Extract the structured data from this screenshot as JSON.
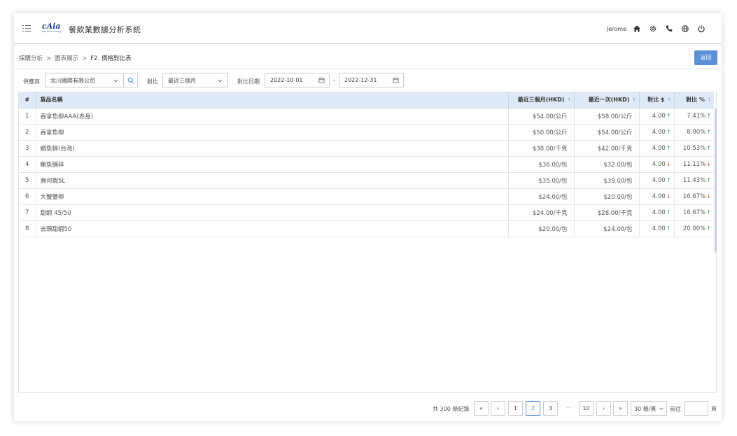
{
  "header": {
    "logo_text": "cAia",
    "logo_subtext": "City of Accounting",
    "app_title": "餐飲業數據分析系統",
    "user_name": "Jerome"
  },
  "breadcrumb": {
    "items": [
      "採購分析",
      "圖表展示",
      "F2. 價格對比表"
    ],
    "separator": ">"
  },
  "back_button": "返回",
  "filters": {
    "supplier_label": "供應商",
    "supplier_value": "北川國際有限公司",
    "compare_label": "對比",
    "compare_value": "最近三個月",
    "date_label": "對比日期",
    "date_from": "2022-10-01",
    "date_separator": "–",
    "date_to": "2022-12-31"
  },
  "table": {
    "columns": [
      "#",
      "貨品名稱",
      "最近三個月(HKD)",
      "最近一次(HKD)",
      "對比 $",
      "對比 %"
    ],
    "rows": [
      {
        "no": "1",
        "name": "吞拿魚柳AAA(赤身)",
        "avg3m": "$54.00/公斤",
        "last": "$58.00/公斤",
        "diff": "4.00",
        "diff_dir": "up",
        "pct": "7.41%",
        "pct_dir": "up"
      },
      {
        "no": "2",
        "name": "吞拿魚柳",
        "avg3m": "$50.00/公斤",
        "last": "$54.00/公斤",
        "diff": "4.00",
        "diff_dir": "up",
        "pct": "8.00%",
        "pct_dir": "up"
      },
      {
        "no": "3",
        "name": "鯛魚柳(台灣)",
        "avg3m": "$38.00/千克",
        "last": "$42.00/千克",
        "diff": "4.00",
        "diff_dir": "up",
        "pct": "10.53%",
        "pct_dir": "up"
      },
      {
        "no": "4",
        "name": "鮪魚腩碎",
        "avg3m": "$36.00/包",
        "last": "$32.00/包",
        "diff": "4.00",
        "diff_dir": "down",
        "pct": "11.11%",
        "pct_dir": "down"
      },
      {
        "no": "5",
        "name": "壽司蝦5L",
        "avg3m": "$35.00/包",
        "last": "$39.00/包",
        "diff": "4.00",
        "diff_dir": "up",
        "pct": "11.43%",
        "pct_dir": "up"
      },
      {
        "no": "6",
        "name": "大蟹蟹柳",
        "avg3m": "$24.00/包",
        "last": "$20.00/包",
        "diff": "4.00",
        "diff_dir": "down",
        "pct": "16.67%",
        "pct_dir": "down"
      },
      {
        "no": "7",
        "name": "甜蝦 45/50",
        "avg3m": "$24.00/千克",
        "last": "$28.00/千克",
        "diff": "4.00",
        "diff_dir": "up",
        "pct": "16.67%",
        "pct_dir": "up"
      },
      {
        "no": "8",
        "name": "去頭甜蝦50",
        "avg3m": "$20.00/包",
        "last": "$24.00/包",
        "diff": "4.00",
        "diff_dir": "up",
        "pct": "20.00%",
        "pct_dir": "up"
      }
    ]
  },
  "pagination": {
    "total_text": "共 300 條紀錄",
    "first": "«",
    "prev": "‹",
    "pages": [
      "1",
      "2",
      "3"
    ],
    "current_page": "2",
    "ellipsis": "···",
    "last_page": "10",
    "next": "›",
    "last": "»",
    "page_size": "30 條/頁",
    "goto_label": "前往",
    "goto_value": "",
    "page_suffix": "頁"
  },
  "colors": {
    "accent": "#5b8fd6",
    "header_bg": "#dfeaf6",
    "up": "#2fa84f",
    "down": "#e0533c"
  }
}
